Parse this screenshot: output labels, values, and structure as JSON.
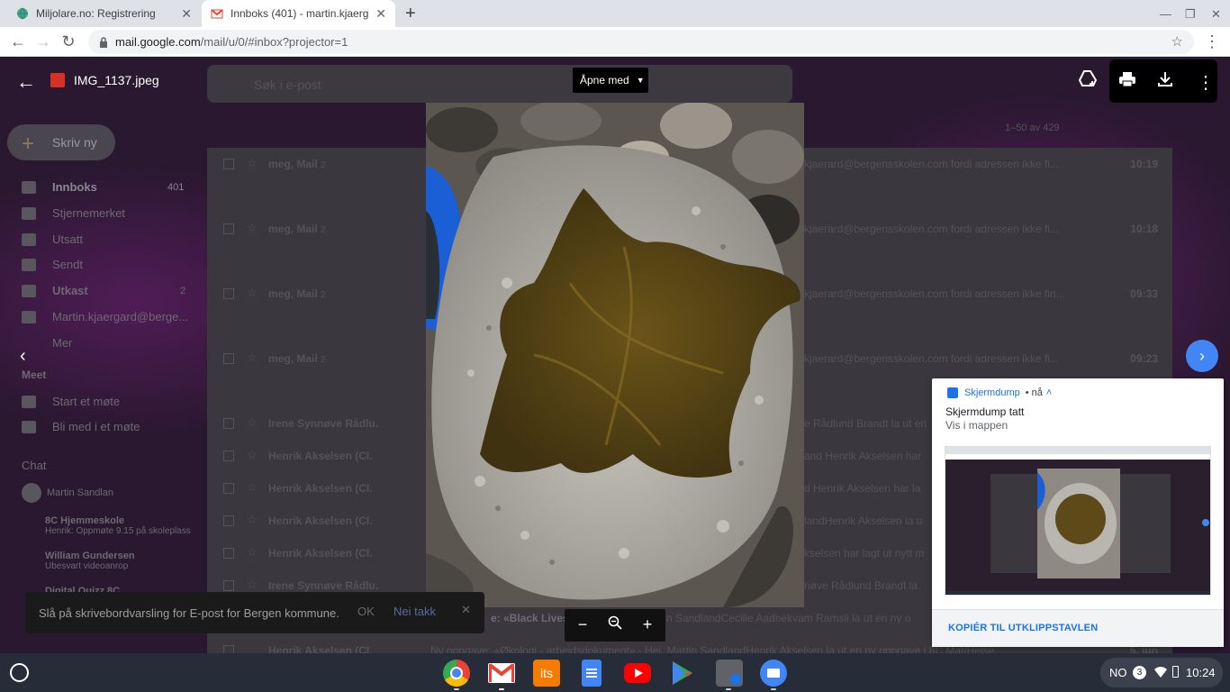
{
  "browser": {
    "tabs": [
      {
        "label": "Miljolare.no: Registrering",
        "active": false
      },
      {
        "label": "Innboks (401) - martin.kjaergard",
        "active": true
      }
    ],
    "url_host": "mail.google.com",
    "url_path": "/mail/u/0/#inbox?projector=1"
  },
  "gmail": {
    "search_placeholder": "Søk i e-post",
    "compose": "Skriv ny",
    "page_range": "1–50 av 429",
    "sidebar": [
      {
        "label": "Innboks",
        "count": "401"
      },
      {
        "label": "Stjernemerket",
        "count": ""
      },
      {
        "label": "Utsatt",
        "count": ""
      },
      {
        "label": "Sendt",
        "count": ""
      },
      {
        "label": "Utkast",
        "count": "2"
      },
      {
        "label": "Martin.kjaergard@berge...",
        "count": ""
      },
      {
        "label": "Mer",
        "count": ""
      }
    ],
    "meet_title": "Meet",
    "meet_items": [
      "Start et møte",
      "Bli med i et møte"
    ],
    "chat_title": "Chat",
    "chat_user": "Martin Sandlan",
    "chats": [
      {
        "name": "8C Hjemmeskole",
        "msg": "Henrik: Oppmøte 9.15 på skoleplass"
      },
      {
        "name": "William Gundersen",
        "msg": "Ubesvart videoanrop"
      },
      {
        "name": "Digital Quizz 8C",
        "msg": ""
      }
    ],
    "mails": [
      {
        "from": "meg, Mail",
        "count": "2",
        "snippet": "kjaerard@bergensskolen.com fordi adressen ikke fi...",
        "time": "10:19"
      },
      {
        "from": "meg, Mail",
        "count": "2",
        "snippet": "kjaerard@bergensskolen.com fordi adressen ikke fi...",
        "time": "10:18"
      },
      {
        "from": "meg, Mail",
        "count": "2",
        "snippet": "kjaerard@bergensskolen.com fordi adressen ikke fin...",
        "time": "09:33"
      },
      {
        "from": "meg, Mail",
        "count": "2",
        "snippet": "kjaerard@bergensskolen.com fordi adressen ikke fi...",
        "time": "09:23"
      },
      {
        "from": "Irene Synnøve Rådlu.",
        "count": "",
        "snippet": "e Rådlund Brandt la ut en",
        "time": ""
      },
      {
        "from": "Henrik Akselsen (Cl.",
        "count": "",
        "snippet": "and Henrik Akselsen har",
        "time": ""
      },
      {
        "from": "Henrik Akselsen (Cl.",
        "count": "",
        "snippet": "d Henrik Akselsen har la",
        "time": ""
      },
      {
        "from": "Henrik Akselsen (Cl.",
        "count": "",
        "snippet": "landHenrik Akselsen la u",
        "time": ""
      },
      {
        "from": "Henrik Akselsen (Cl.",
        "count": "",
        "snippet": "kselsen har lagt ut nytt m",
        "time": ""
      },
      {
        "from": "Irene Synnøve Rådlu.",
        "count": "",
        "snippet": "nøve Rådlund Brandt la",
        "time": ""
      },
      {
        "from": "Henrik Akselsen (Cl.",
        "count": "",
        "snippet": "Ny oppgave: «Økologi - arbeidsdokument» - Hei, Martin SandlandHenrik Akselsen la ut en ny oppgave i 8C Mat/Helse",
        "time": "5. jun"
      }
    ],
    "mail_subject_partial": "e: «Black Lives",
    "mail_subject_rest": "n SandlandCecilie Aadnekvam Ramsli la ut en ny o",
    "snackbar": {
      "text": "Slå på skrivebordvarsling for E-post for Bergen kommune.",
      "ok": "OK",
      "no": "Nei takk"
    }
  },
  "viewer": {
    "filename": "IMG_1137.jpeg",
    "open_with": "Åpne med"
  },
  "notification": {
    "app": "Skjermdump",
    "when": "• nå",
    "title": "Skjermdump tatt",
    "subtitle": "Vis i mappen",
    "action": "KOPIÉR TIL UTKLIPPSTAVLEN"
  },
  "shelf": {
    "apps": [
      "Chrome",
      "Gmail",
      "itslearning",
      "Docs",
      "YouTube",
      "Play Store",
      "Calculator",
      "Files"
    ],
    "its_label": "its",
    "locale": "NO",
    "notif_count": "3",
    "time": "10:24"
  },
  "colors": {
    "accent": "#4285f4",
    "gmail_red": "#ea4335",
    "shelf": "#262d38"
  }
}
